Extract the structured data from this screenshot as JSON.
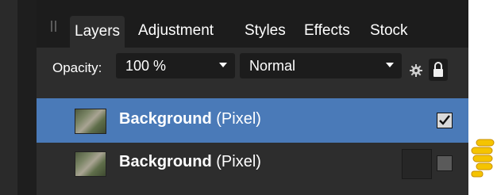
{
  "tabs": [
    {
      "label": "Layers",
      "active": true
    },
    {
      "label": "Adjustment",
      "active": false
    },
    {
      "label": "Styles",
      "active": false
    },
    {
      "label": "Effects",
      "active": false
    },
    {
      "label": "Stock",
      "active": false
    }
  ],
  "options": {
    "opacity_label": "Opacity:",
    "opacity_value": "100 %",
    "blend_mode": "Normal"
  },
  "layers": [
    {
      "name": "Background",
      "type": "(Pixel)",
      "selected": true,
      "visible": true
    },
    {
      "name": "Background",
      "type": "(Pixel)",
      "selected": false,
      "visible": false
    }
  ],
  "icons": {
    "settings": "gear-icon",
    "lock": "lock-icon",
    "pointer": "pointing-hand-icon"
  },
  "colors": {
    "panel_bg": "#2d2d2d",
    "tabbar_bg": "#1c1c1c",
    "selected_row": "#4a7ab8",
    "pointer": "#f5c400"
  }
}
